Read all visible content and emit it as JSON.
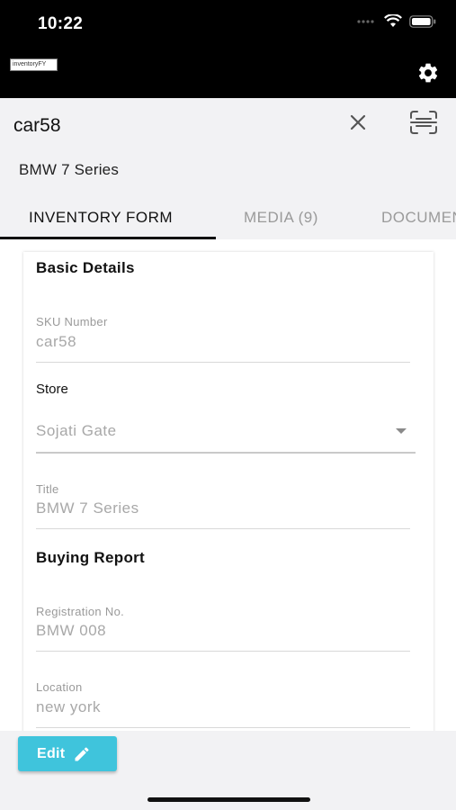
{
  "status_bar": {
    "time": "10:22"
  },
  "app_bar": {
    "logo_text": "inventoryFY"
  },
  "header": {
    "vehicle_id": "car58",
    "vehicle_name": "BMW 7 Series"
  },
  "tabs": [
    {
      "label": "INVENTORY FORM",
      "active": true
    },
    {
      "label": "MEDIA (9)",
      "active": false
    },
    {
      "label": "DOCUMENTS",
      "active": false
    }
  ],
  "form": {
    "basic_details_title": "Basic Details",
    "sku": {
      "label": "SKU Number",
      "value": "car58"
    },
    "store": {
      "label": "Store",
      "value": "Sojati Gate"
    },
    "title": {
      "label": "Title",
      "value": "BMW 7 Series"
    },
    "buying_report_title": "Buying Report",
    "registration": {
      "label": "Registration No.",
      "value": "BMW 008"
    },
    "location": {
      "label": "Location",
      "value": "new york"
    }
  },
  "actions": {
    "edit_label": "Edit"
  },
  "colors": {
    "accent": "#3fc4dc",
    "appbar": "#000000"
  }
}
